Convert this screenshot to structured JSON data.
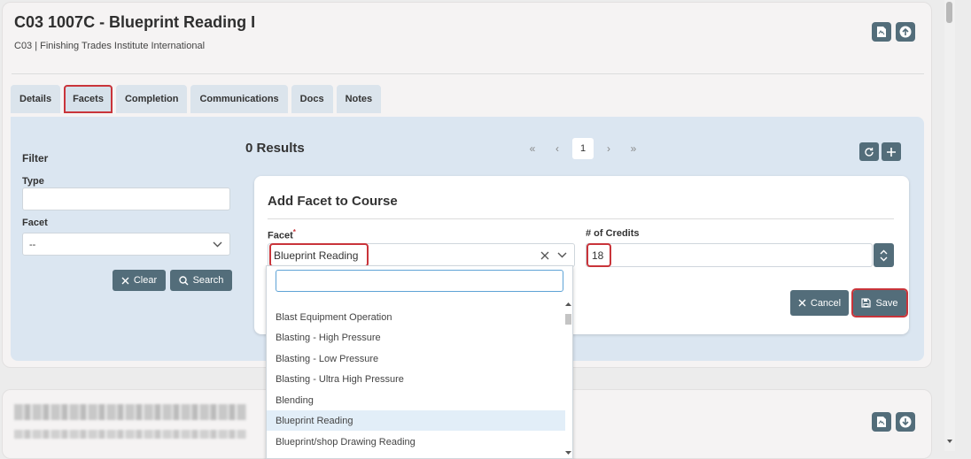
{
  "header": {
    "title": "C03 1007C - Blueprint Reading I",
    "subtitle": "C03 | Finishing Trades Institute International"
  },
  "tabs": [
    {
      "label": "Details"
    },
    {
      "label": "Facets"
    },
    {
      "label": "Completion"
    },
    {
      "label": "Communications"
    },
    {
      "label": "Docs"
    },
    {
      "label": "Notes"
    }
  ],
  "filter": {
    "heading": "Filter",
    "type_label": "Type",
    "type_value": "",
    "facet_label": "Facet",
    "facet_value": "--",
    "clear_label": "Clear",
    "search_label": "Search"
  },
  "results": {
    "count_text": "0 Results",
    "pager": {
      "first": "«",
      "prev": "‹",
      "current": "1",
      "next": "›",
      "last": "»"
    }
  },
  "modal": {
    "title": "Add Facet to Course",
    "facet_label": "Facet",
    "required_mark": "*",
    "facet_value": "Blueprint Reading",
    "credits_label": "# of Credits",
    "credits_value": "18",
    "cancel_label": "Cancel",
    "save_label": "Save"
  },
  "dropdown": {
    "search_value": "",
    "options": [
      {
        "label": "Blast Equipment Operation",
        "selected": false
      },
      {
        "label": "Blasting - High Pressure",
        "selected": false
      },
      {
        "label": "Blasting - Low Pressure",
        "selected": false
      },
      {
        "label": "Blasting - Ultra High Pressure",
        "selected": false
      },
      {
        "label": "Blending",
        "selected": false
      },
      {
        "label": "Blueprint Reading",
        "selected": true
      },
      {
        "label": "Blueprint/shop Drawing Reading",
        "selected": false
      }
    ]
  },
  "colors": {
    "button": "#536d7a",
    "highlight": "#c9343a",
    "panel": "#dbe6f1",
    "selected_option": "#e2eef8"
  }
}
